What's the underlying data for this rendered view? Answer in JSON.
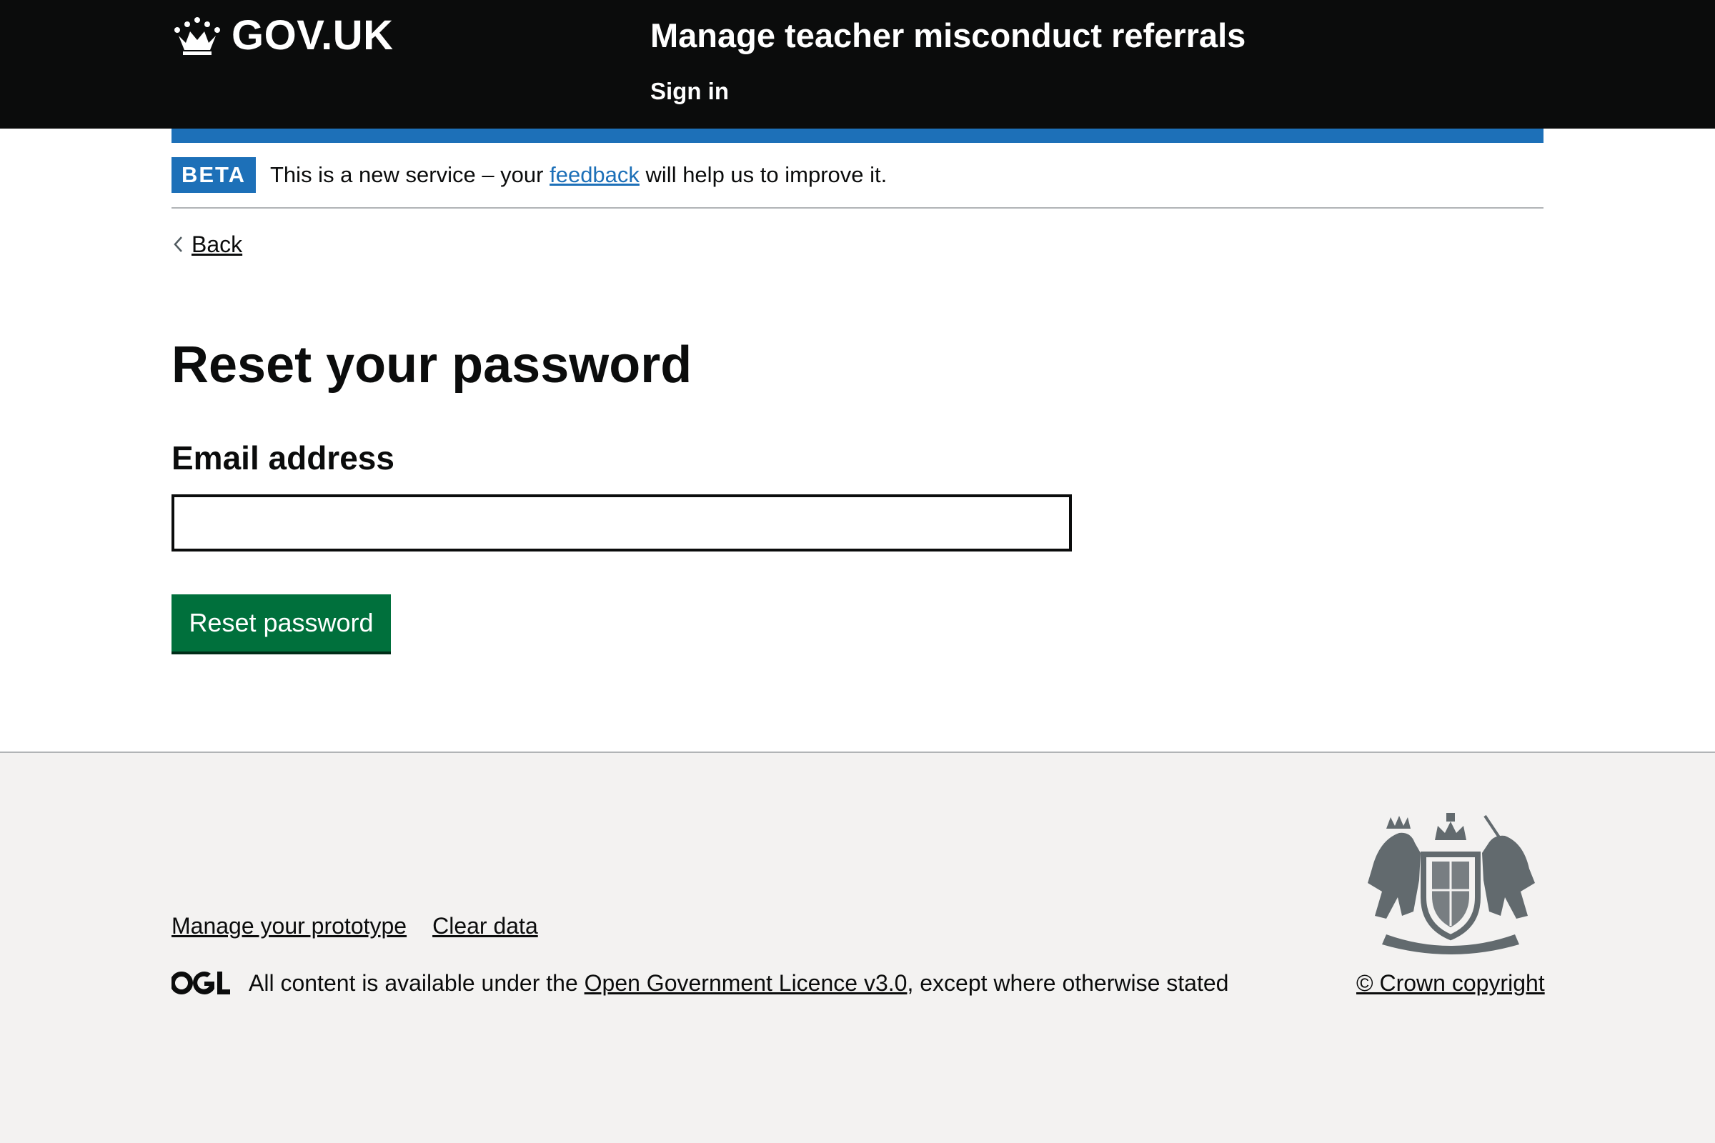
{
  "header": {
    "logo_text": "GOV.UK",
    "service_name": "Manage teacher misconduct referrals",
    "sign_in": "Sign in"
  },
  "phase_banner": {
    "tag": "BETA",
    "text_before": "This is a new service – your ",
    "link": "feedback",
    "text_after": " will help us to improve it."
  },
  "back_link": "Back",
  "main": {
    "title": "Reset your password",
    "email_label": "Email address",
    "email_value": "",
    "submit_label": "Reset password"
  },
  "footer": {
    "links": [
      "Manage your prototype",
      "Clear data"
    ],
    "licence_before": "All content is available under the ",
    "licence_link": "Open Government Licence v3.0",
    "licence_after": ", except where otherwise stated",
    "copyright": "© Crown copyright"
  },
  "colors": {
    "header_bg": "#0b0c0c",
    "brand_blue": "#1d70b8",
    "button_green": "#00703c",
    "footer_bg": "#f3f2f1",
    "crest_grey": "#626a6e"
  },
  "icons": [
    "crown-icon",
    "chevron-left-icon",
    "ogl-icon",
    "royal-crest-icon"
  ]
}
